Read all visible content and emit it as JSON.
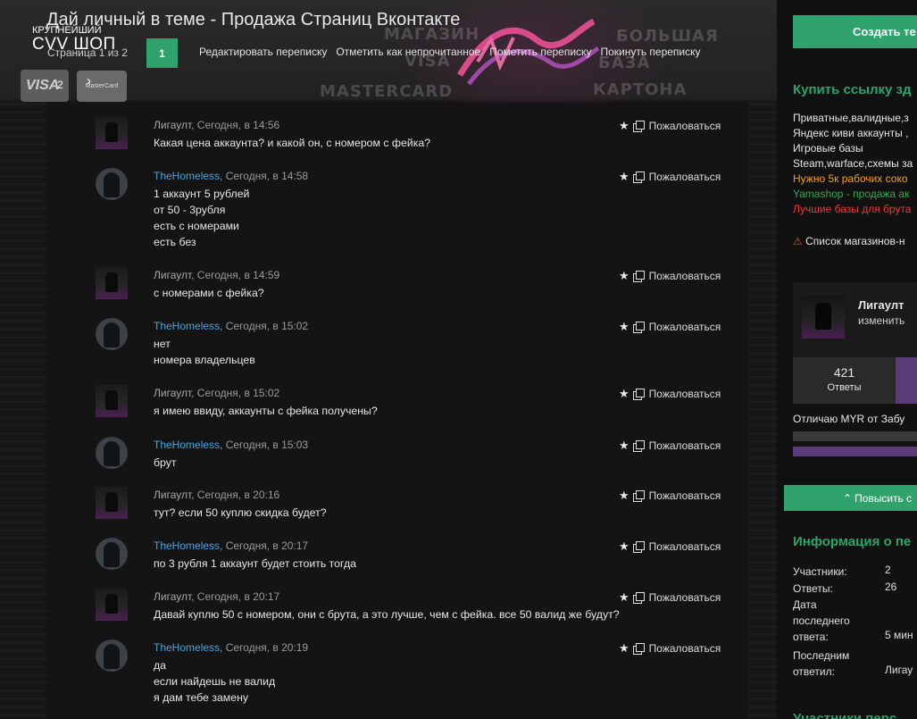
{
  "header": {
    "title": "Дай личный в теме - Продажа Страниц Вконтакте",
    "brand_top": "КРУПНЕЙШИЙ",
    "brand_main": "CVV ШОП",
    "page_indicator": "Страница 1 из 2",
    "current_page": "1",
    "next_page": "2",
    "actions": [
      "Редактировать переписку",
      "Отметить как непрочитанное",
      "Пометить переписку",
      "Покинуть переписку"
    ],
    "banner_words": [
      "МАГАЗИН",
      "VISA",
      "MASTERCARD",
      "БОЛЬШАЯ",
      "БАЗА",
      "КАРТОНА"
    ],
    "card_visa": "VISA",
    "card_mc": "MasterCard"
  },
  "messages": [
    {
      "author": "Лигаулт",
      "author_type": "grey",
      "time": ", Сегодня, в 14:56",
      "lines": [
        "Какая цена аккаунта? и какой он, с номером с фейка?"
      ]
    },
    {
      "author": "TheHomeless",
      "author_type": "blue",
      "time": ", Сегодня, в 14:58",
      "lines": [
        "1 аккаунт 5 рублей",
        "от 50 - 3рубля",
        "есть с номерами",
        "есть без"
      ]
    },
    {
      "author": "Лигаулт",
      "author_type": "grey",
      "time": ", Сегодня, в 14:59",
      "lines": [
        "с номерами с фейка?"
      ]
    },
    {
      "author": "TheHomeless",
      "author_type": "blue",
      "time": ", Сегодня, в 15:02",
      "lines": [
        "нет",
        "номера владельцев"
      ]
    },
    {
      "author": "Лигаулт",
      "author_type": "grey",
      "time": ", Сегодня, в 15:02",
      "lines": [
        "я имею ввиду, аккаунты с фейка получены?"
      ]
    },
    {
      "author": "TheHomeless",
      "author_type": "blue",
      "time": ", Сегодня, в 15:03",
      "lines": [
        "брут"
      ]
    },
    {
      "author": "Лигаулт",
      "author_type": "grey",
      "time": ", Сегодня, в 20:16",
      "lines": [
        "тут? если 50 куплю скидка будет?"
      ]
    },
    {
      "author": "TheHomeless",
      "author_type": "blue",
      "time": ", Сегодня, в 20:17",
      "lines": [
        "по 3 рубля 1 аккаунт будет стоить тогда"
      ]
    },
    {
      "author": "Лигаулт",
      "author_type": "grey",
      "time": ", Сегодня, в 20:17",
      "lines": [
        "Давай куплю 50 с номером, они с брута, а это лучше, чем с фейка. все 50 валид же будут?"
      ]
    },
    {
      "author": "TheHomeless",
      "author_type": "blue",
      "time": ", Сегодня, в 20:19",
      "lines": [
        "да",
        "если найдешь не валид",
        "я дам тебе замену"
      ]
    }
  ],
  "message_actions": {
    "report": "Пожаловаться"
  },
  "sidebar": {
    "create_button": "Создать те",
    "buy_heading": "Купить ссылку зд",
    "ads": [
      {
        "text": "Приватные,валидные,з",
        "color": "#e6e6e6"
      },
      {
        "text": "Яндекс киви аккаунты ,",
        "color": "#e6e6e6"
      },
      {
        "text": "Игровые базы",
        "color": "#e6e6e6"
      },
      {
        "text": "Steam,warface,схемы за",
        "color": "#e6e6e6"
      },
      {
        "text": "Нужно 5к рабочих соко",
        "color": "#f0a020"
      },
      {
        "text": "Yamashop - продажа ак",
        "color": "#3aa64a"
      },
      {
        "text": "Лучшие базы для брута",
        "color": "#e83a3a"
      }
    ],
    "warning": "Список магазинов-н",
    "user_name": "Лигаулт",
    "user_edit": "изменить",
    "stat_num": "421",
    "stat_label": "Ответы",
    "note": "Отличаю MYR от Забу",
    "promote_button": "Повысить с",
    "info_heading": "Информация о пе",
    "info": [
      {
        "k": "Участники:",
        "v": "2"
      },
      {
        "k": "Ответы:",
        "v": "26"
      },
      {
        "k": "Дата\nпоследнего\nответа:",
        "v": "5 мин"
      },
      {
        "k": "Последним\nответил:",
        "v": "Лигау"
      }
    ],
    "bottom_heading": "Участники перс"
  }
}
